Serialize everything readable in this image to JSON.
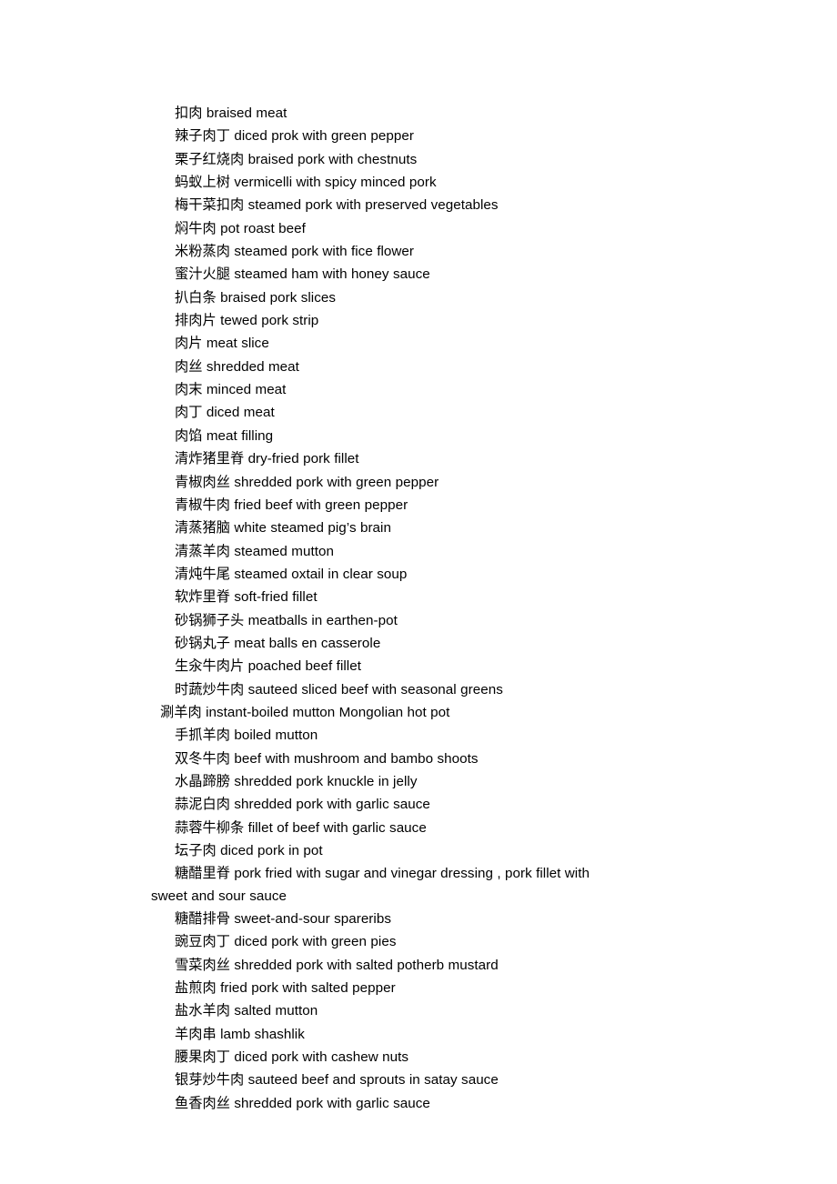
{
  "document": {
    "type": "glossary-list",
    "language_pair": "Chinese-English",
    "subject": "Chinese dish names with English translations",
    "entries": [
      {
        "cn": "扣肉",
        "en": "braised meat",
        "outdent": false
      },
      {
        "cn": "辣子肉丁",
        "en": "diced prok with green pepper",
        "outdent": false
      },
      {
        "cn": "栗子红烧肉",
        "en": "braised pork with chestnuts",
        "outdent": false
      },
      {
        "cn": "蚂蚁上树",
        "en": "vermicelli with spicy minced pork",
        "outdent": false
      },
      {
        "cn": "梅干菜扣肉",
        "en": "steamed pork with preserved vegetables",
        "outdent": false
      },
      {
        "cn": "焖牛肉",
        "en": "pot roast beef",
        "outdent": false
      },
      {
        "cn": "米粉蒸肉",
        "en": "steamed pork with fice flower",
        "outdent": false
      },
      {
        "cn": "蜜汁火腿",
        "en": "steamed ham with honey sauce",
        "outdent": false
      },
      {
        "cn": "扒白条",
        "en": "braised pork slices",
        "outdent": false
      },
      {
        "cn": "排肉片",
        "en": "tewed pork strip",
        "outdent": false
      },
      {
        "cn": "肉片",
        "en": "meat slice",
        "outdent": false
      },
      {
        "cn": "肉丝",
        "en": "shredded meat",
        "outdent": false
      },
      {
        "cn": "肉末",
        "en": "minced meat",
        "outdent": false
      },
      {
        "cn": "肉丁",
        "en": "diced meat",
        "outdent": false
      },
      {
        "cn": "肉馅",
        "en": "meat filling",
        "outdent": false
      },
      {
        "cn": "清炸猪里脊",
        "en": "dry-fried pork fillet",
        "outdent": false
      },
      {
        "cn": "青椒肉丝",
        "en": "shredded pork with green pepper",
        "outdent": false
      },
      {
        "cn": "青椒牛肉",
        "en": "fried beef with green pepper",
        "outdent": false
      },
      {
        "cn": "清蒸猪脑",
        "en": "white steamed pig’s brain",
        "outdent": false
      },
      {
        "cn": "清蒸羊肉",
        "en": "steamed mutton",
        "outdent": false
      },
      {
        "cn": "清炖牛尾",
        "en": "steamed oxtail in clear soup",
        "outdent": false
      },
      {
        "cn": "软炸里脊",
        "en": "soft-fried fillet",
        "outdent": false
      },
      {
        "cn": "砂锅狮子头",
        "en": "meatballs in earthen-pot",
        "outdent": false
      },
      {
        "cn": "砂锅丸子",
        "en": "meat balls en casserole",
        "outdent": false
      },
      {
        "cn": "生汆牛肉片",
        "en": "poached beef fillet",
        "outdent": false
      },
      {
        "cn": "时蔬炒牛肉",
        "en": "sauteed sliced beef with seasonal greens",
        "outdent": false
      },
      {
        "cn": "涮羊肉",
        "en": "instant-boiled mutton Mongolian hot pot",
        "outdent": true
      },
      {
        "cn": "手抓羊肉",
        "en": "boiled mutton",
        "outdent": false
      },
      {
        "cn": "双冬牛肉",
        "en": "beef with mushroom and bambo shoots",
        "outdent": false
      },
      {
        "cn": "水晶蹄膀",
        "en": "shredded pork knuckle in jelly",
        "outdent": false
      },
      {
        "cn": "蒜泥白肉",
        "en": "shredded pork with garlic sauce",
        "outdent": false
      },
      {
        "cn": "蒜蓉牛柳条",
        "en": "fillet of beef with garlic sauce",
        "outdent": false
      },
      {
        "cn": "坛子肉",
        "en": "diced pork in pot",
        "outdent": false
      },
      {
        "cn": "糖醋里脊",
        "en": "pork fried with sugar and vinegar dressing , pork fillet with sweet and sour sauce",
        "outdent": false
      },
      {
        "cn": "糖醋排骨",
        "en": "sweet-and-sour spareribs",
        "outdent": false
      },
      {
        "cn": "豌豆肉丁",
        "en": "diced pork with green pies",
        "outdent": false
      },
      {
        "cn": "雪菜肉丝",
        "en": "shredded pork with salted potherb mustard",
        "outdent": false
      },
      {
        "cn": "盐煎肉",
        "en": "fried pork with salted pepper",
        "outdent": false
      },
      {
        "cn": "盐水羊肉",
        "en": "salted mutton",
        "outdent": false
      },
      {
        "cn": "羊肉串",
        "en": "lamb shashlik",
        "outdent": false
      },
      {
        "cn": "腰果肉丁",
        "en": "diced pork with cashew nuts",
        "outdent": false
      },
      {
        "cn": "银芽炒牛肉",
        "en": "sauteed beef and sprouts in satay sauce",
        "outdent": false
      },
      {
        "cn": "鱼香肉丝",
        "en": "shredded pork with garlic sauce",
        "outdent": false
      }
    ]
  }
}
